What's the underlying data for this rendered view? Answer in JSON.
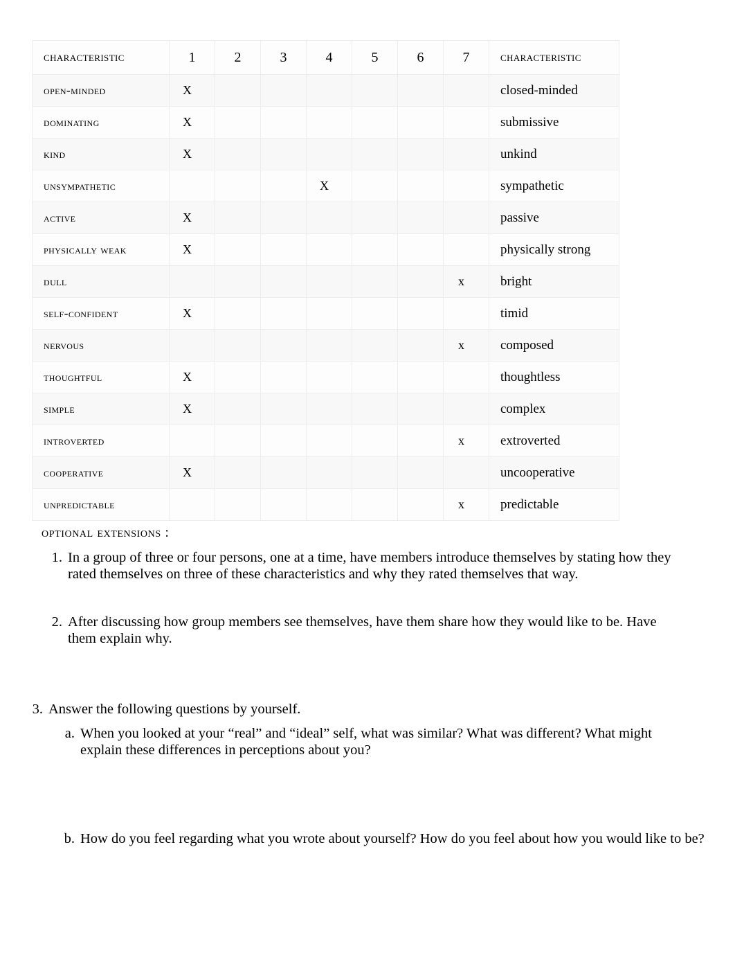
{
  "table": {
    "header": {
      "left_label": "Characteristic",
      "scale": [
        "1",
        "2",
        "3",
        "4",
        "5",
        "6",
        "7"
      ],
      "right_label": "Characteristic"
    },
    "columns": 7,
    "rows": [
      {
        "left": "open-minded",
        "right": "closed-minded",
        "mark": "X",
        "mark_column": 1
      },
      {
        "left": "dominating",
        "right": "submissive",
        "mark": "X",
        "mark_column": 1
      },
      {
        "left": "kind",
        "right": "unkind",
        "mark": "X",
        "mark_column": 1
      },
      {
        "left": "unsympathetic",
        "right": "sympathetic",
        "mark": "X",
        "mark_column": 4
      },
      {
        "left": "active",
        "right": "passive",
        "mark": "X",
        "mark_column": 1
      },
      {
        "left": "physically weak",
        "right": "physically strong",
        "mark": "X",
        "mark_column": 1
      },
      {
        "left": "dull",
        "right": "bright",
        "mark": "x",
        "mark_column": 7
      },
      {
        "left": "self-confident",
        "right": "timid",
        "mark": "X",
        "mark_column": 1
      },
      {
        "left": "nervous",
        "right": "composed",
        "mark": "x",
        "mark_column": 7
      },
      {
        "left": "thoughtful",
        "right": "thoughtless",
        "mark": "X",
        "mark_column": 1
      },
      {
        "left": "simple",
        "right": "complex",
        "mark": "X",
        "mark_column": 1
      },
      {
        "left": "introverted",
        "right": "extroverted",
        "mark": "x",
        "mark_column": 7
      },
      {
        "left": "cooperative",
        "right": "uncooperative",
        "mark": "X",
        "mark_column": 1
      },
      {
        "left": "unpredictable",
        "right": "predictable",
        "mark": "x",
        "mark_column": 7
      }
    ]
  },
  "extensions": {
    "heading": "Optional  Extensions :",
    "items": [
      {
        "marker": "1.",
        "text": "In a group of three or four persons, one at a time, have members introduce themselves by stating how they rated themselves on three of these characteristics and why they rated themselves that way."
      },
      {
        "marker": "2.",
        "text": "After discussing how group members see themselves, have them share how they would like to be. Have them explain why."
      },
      {
        "marker": "3.",
        "text": "Answer the following questions by yourself."
      }
    ],
    "subitems": [
      {
        "marker": "a.",
        "text": "When you looked at your “real” and “ideal” self, what was similar? What was different? What might explain these differences in perceptions about you?"
      },
      {
        "marker": "b.",
        "text": "How do you feel regarding what you wrote about yourself? How do you feel about how you would like to be?"
      }
    ]
  }
}
